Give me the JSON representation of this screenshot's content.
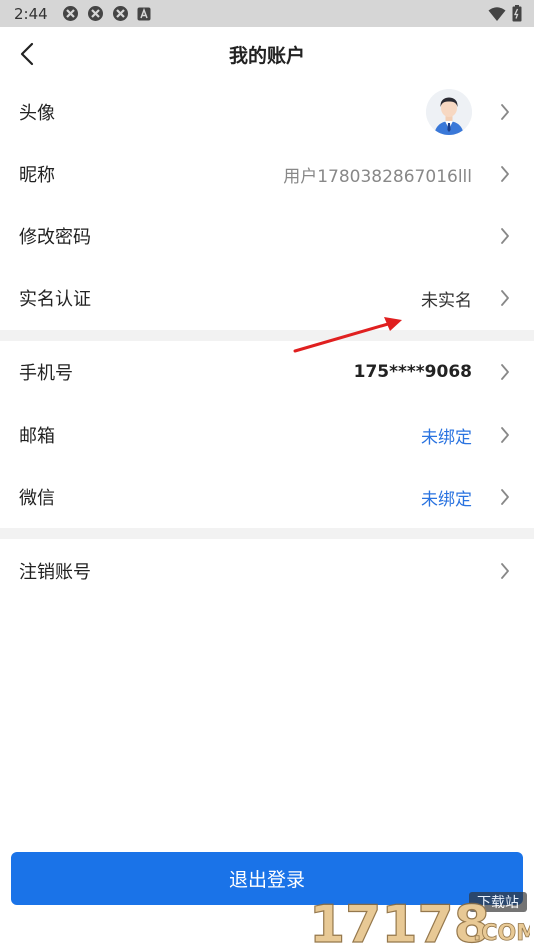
{
  "status_bar": {
    "time": "2:44"
  },
  "header": {
    "title": "我的账户"
  },
  "rows": [
    {
      "label": "头像",
      "value": ""
    },
    {
      "label": "昵称",
      "value": "用户1780382867016lll"
    },
    {
      "label": "修改密码",
      "value": ""
    },
    {
      "label": "实名认证",
      "value": "未实名"
    },
    {
      "label": "手机号",
      "value": "175****9068"
    },
    {
      "label": "邮箱",
      "value": "未绑定"
    },
    {
      "label": "微信",
      "value": "未绑定"
    },
    {
      "label": "注销账号",
      "value": ""
    }
  ],
  "logout": {
    "label": "退出登录"
  },
  "watermark": {
    "main": "17178",
    "sub": "下载站",
    "domain": ".COM"
  },
  "colors": {
    "primary": "#1a73e8",
    "link": "#2a73e0",
    "annotation": "#e02020"
  }
}
